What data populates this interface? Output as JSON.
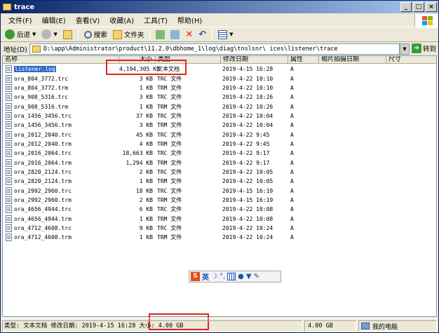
{
  "window": {
    "title": "trace",
    "minimize": "_",
    "maximize": "□",
    "close": "×"
  },
  "menu": [
    "文件(F)",
    "编辑(E)",
    "查看(V)",
    "收藏(A)",
    "工具(T)",
    "帮助(H)"
  ],
  "toolbar": {
    "back": "后退",
    "search": "搜索",
    "folders": "文件夹"
  },
  "address": {
    "label": "地址(D)",
    "value": "D:\\app\\Administrator\\product\\11.2.0\\dbhome_1\\log\\diag\\tnslsnr\\        ices\\listener\\trace",
    "go": "转到"
  },
  "columns": [
    "名称",
    "大小",
    "类型",
    "修改日期",
    "属性",
    "相片拍摄日期",
    "尺寸"
  ],
  "files": [
    {
      "name": "listener.log",
      "size": "4,194,305 KB",
      "type": "文本文档",
      "date": "2019-4-15 16:28",
      "attr": "A",
      "selected": true
    },
    {
      "name": "ora_804_3772.trc",
      "size": "3 KB",
      "type": "TRC 文件",
      "date": "2019-4-22 10:10",
      "attr": "A"
    },
    {
      "name": "ora_804_3772.trm",
      "size": "1 KB",
      "type": "TRM 文件",
      "date": "2019-4-22 10:10",
      "attr": "A"
    },
    {
      "name": "ora_908_5316.trc",
      "size": "3 KB",
      "type": "TRC 文件",
      "date": "2019-4-22 10:26",
      "attr": "A"
    },
    {
      "name": "ora_908_5316.trm",
      "size": "1 KB",
      "type": "TRM 文件",
      "date": "2019-4-22 10:26",
      "attr": "A"
    },
    {
      "name": "ora_1456_3456.trc",
      "size": "37 KB",
      "type": "TRC 文件",
      "date": "2019-4-22 10:04",
      "attr": "A"
    },
    {
      "name": "ora_1456_3456.trm",
      "size": "3 KB",
      "type": "TRM 文件",
      "date": "2019-4-22 10:04",
      "attr": "A"
    },
    {
      "name": "ora_2012_2040.trc",
      "size": "45 KB",
      "type": "TRC 文件",
      "date": "2019-4-22 9:45",
      "attr": "A"
    },
    {
      "name": "ora_2012_2040.trm",
      "size": "4 KB",
      "type": "TRM 文件",
      "date": "2019-4-22 9:45",
      "attr": "A"
    },
    {
      "name": "ora_2016_2064.trc",
      "size": "18,663 KB",
      "type": "TRC 文件",
      "date": "2019-4-22 9:17",
      "attr": "A"
    },
    {
      "name": "ora_2016_2064.trm",
      "size": "1,294 KB",
      "type": "TRM 文件",
      "date": "2019-4-22 9:17",
      "attr": "A"
    },
    {
      "name": "ora_2820_2124.trc",
      "size": "2 KB",
      "type": "TRC 文件",
      "date": "2019-4-22 10:05",
      "attr": "A"
    },
    {
      "name": "ora_2820_2124.trm",
      "size": "1 KB",
      "type": "TRM 文件",
      "date": "2019-4-22 10:05",
      "attr": "A"
    },
    {
      "name": "ora_2992_2960.trc",
      "size": "18 KB",
      "type": "TRC 文件",
      "date": "2019-4-15 16:19",
      "attr": "A"
    },
    {
      "name": "ora_2992_2960.trm",
      "size": "2 KB",
      "type": "TRM 文件",
      "date": "2019-4-15 16:19",
      "attr": "A"
    },
    {
      "name": "ora_4656_4944.trc",
      "size": "6 KB",
      "type": "TRC 文件",
      "date": "2019-4-22 10:08",
      "attr": "A"
    },
    {
      "name": "ora_4656_4944.trm",
      "size": "1 KB",
      "type": "TRM 文件",
      "date": "2019-4-22 10:08",
      "attr": "A"
    },
    {
      "name": "ora_4712_4608.trc",
      "size": "9 KB",
      "type": "TRC 文件",
      "date": "2019-4-22 10:24",
      "attr": "A"
    },
    {
      "name": "ora_4712_4608.trm",
      "size": "1 KB",
      "type": "TRM 文件",
      "date": "2019-4-22 10:24",
      "attr": "A"
    }
  ],
  "ime": {
    "label": "英"
  },
  "status": {
    "main": "类型: 文本文档 修改日期: 2019-4-15 16:28 大小: 4.00 GB",
    "size": "4.00 GB",
    "computer": "我的电脑"
  },
  "colors": {
    "highlight": "#e0261f",
    "selection": "#316ac5",
    "titlebar": "#0a246a"
  }
}
